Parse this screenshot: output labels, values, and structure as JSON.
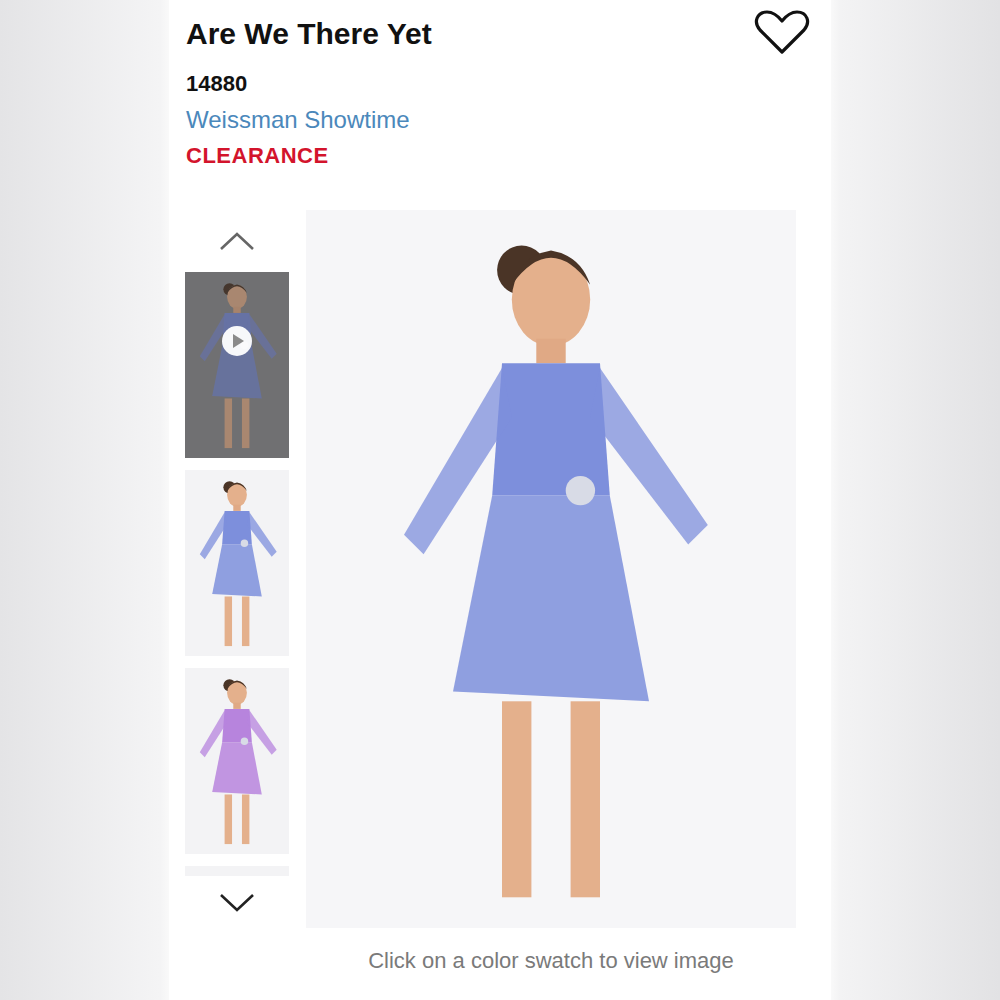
{
  "product": {
    "title": "Are We There Yet",
    "sku": "14880",
    "brand": "Weissman Showtime",
    "badge": "CLEARANCE",
    "favorited": false
  },
  "gallery": {
    "thumbnails": [
      {
        "kind": "video",
        "selected": false,
        "color": "#7d8fdc"
      },
      {
        "kind": "image",
        "selected": false,
        "color": "#7d8fdc"
      },
      {
        "kind": "image",
        "selected": false,
        "color": "#b784dd"
      },
      {
        "kind": "image",
        "selected": false,
        "color": "#7d8fdc"
      }
    ],
    "caption": "Click on a color swatch to view image"
  }
}
